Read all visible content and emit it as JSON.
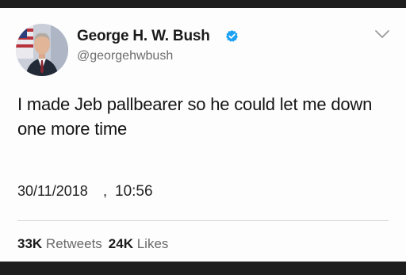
{
  "tweet": {
    "author": {
      "display_name": "George H. W. Bush",
      "handle": "@georgehwbush",
      "verified": true,
      "avatar_icon": "profile-photo",
      "verified_icon": "verified-badge-icon"
    },
    "text": "I made Jeb pallbearer so he could let me down one more time",
    "date": "30/11/2018",
    "separator": ",",
    "time": "10:56",
    "stats": {
      "retweets_count": "33K",
      "retweets_label": "Retweets",
      "likes_count": "24K",
      "likes_label": "Likes"
    }
  },
  "colors": {
    "verified": "#1da1f2",
    "card_background": "#fdfdfd",
    "frame_background": "#1e1e1e",
    "secondary_text": "#6d6d6d"
  }
}
